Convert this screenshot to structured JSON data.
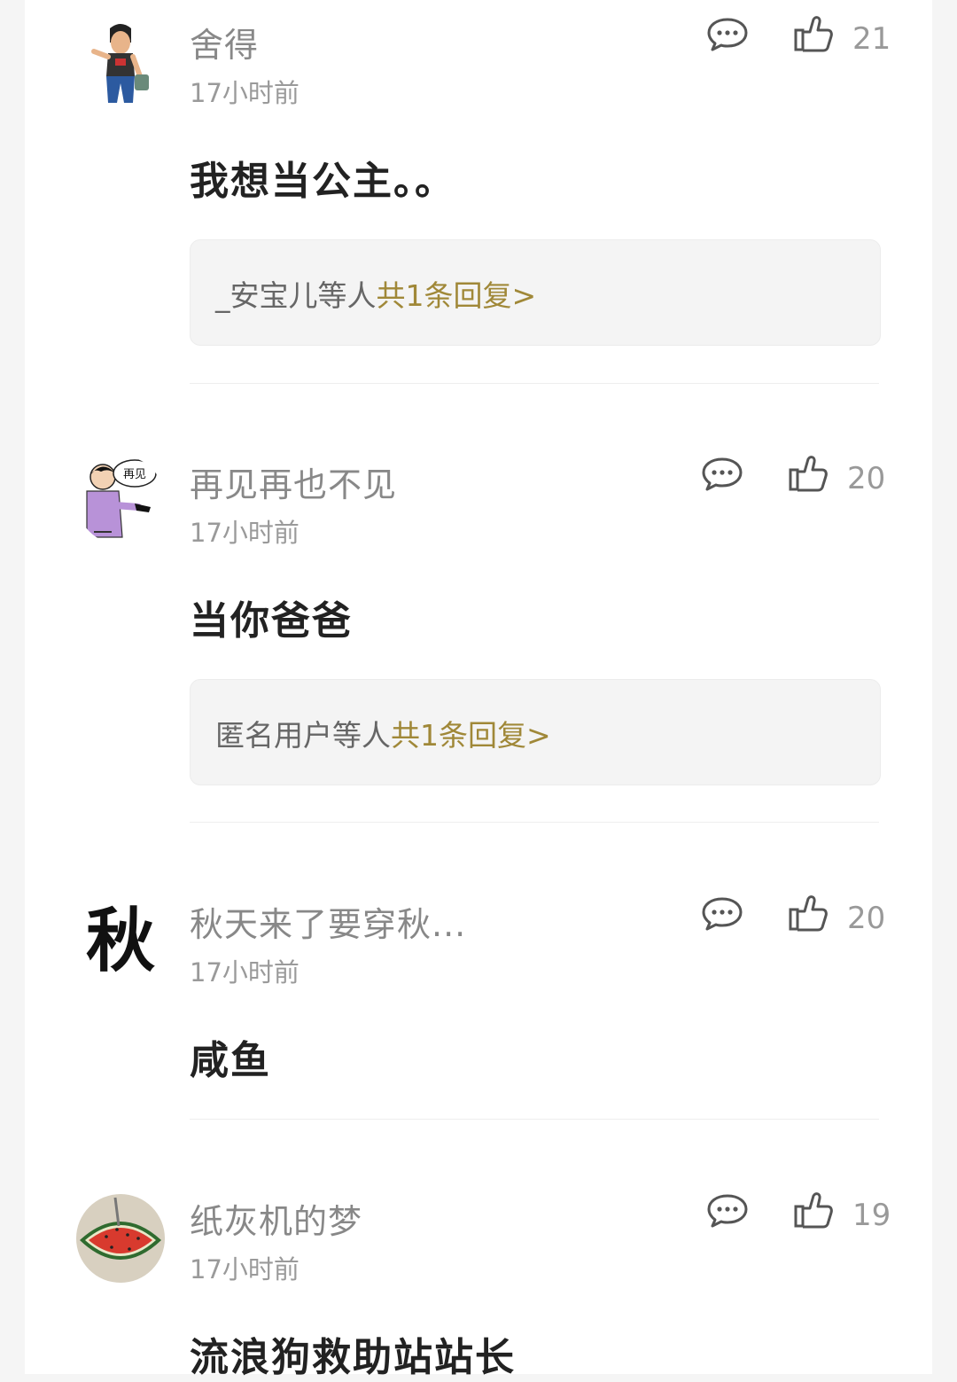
{
  "comments": [
    {
      "name": "舍得",
      "time": "17小时前",
      "text": "我想当公主。。",
      "likes": "21",
      "reply_preview": {
        "users": "_安宝儿等人",
        "total": "共1条回复>"
      }
    },
    {
      "name": "再见再也不见",
      "time": "17小时前",
      "text": "当你爸爸",
      "likes": "20",
      "avatar_caption": "再见",
      "reply_preview": {
        "users": "匿名用户等人",
        "total": "共1条回复>"
      }
    },
    {
      "name": "秋天来了要穿秋...",
      "time": "17小时前",
      "text": "咸鱼",
      "likes": "20",
      "avatar_glyph": "秋"
    },
    {
      "name": "纸灰机的梦",
      "time": "17小时前",
      "text": "流浪狗救助站站长",
      "likes": "19"
    }
  ],
  "icons": {
    "reply": "speech-bubble-icon",
    "like": "thumbs-up-icon"
  },
  "colors": {
    "reply_link": "#a08838",
    "name": "#888888",
    "text": "#222222"
  }
}
